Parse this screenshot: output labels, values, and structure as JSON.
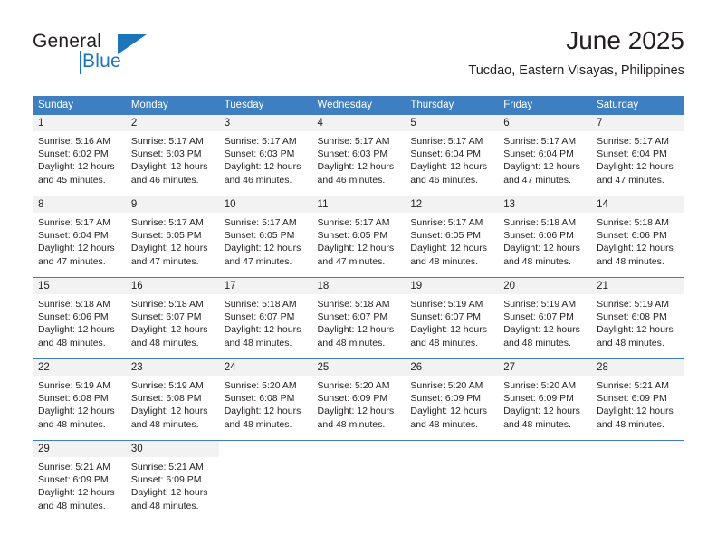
{
  "brand": {
    "name_part1": "General",
    "name_part2": "Blue",
    "accent_color": "#1b75bb"
  },
  "header": {
    "title": "June 2025",
    "subtitle": "Tucdao, Eastern Visayas, Philippines"
  },
  "calendar": {
    "header_color": "#3d7fc1",
    "daynum_band_color": "#f2f2f2",
    "weekday_headers": [
      "Sunday",
      "Monday",
      "Tuesday",
      "Wednesday",
      "Thursday",
      "Friday",
      "Saturday"
    ],
    "weeks": [
      [
        {
          "day": "1",
          "sunrise": "Sunrise: 5:16 AM",
          "sunset": "Sunset: 6:02 PM",
          "daylight": "Daylight: 12 hours and 45 minutes."
        },
        {
          "day": "2",
          "sunrise": "Sunrise: 5:17 AM",
          "sunset": "Sunset: 6:03 PM",
          "daylight": "Daylight: 12 hours and 46 minutes."
        },
        {
          "day": "3",
          "sunrise": "Sunrise: 5:17 AM",
          "sunset": "Sunset: 6:03 PM",
          "daylight": "Daylight: 12 hours and 46 minutes."
        },
        {
          "day": "4",
          "sunrise": "Sunrise: 5:17 AM",
          "sunset": "Sunset: 6:03 PM",
          "daylight": "Daylight: 12 hours and 46 minutes."
        },
        {
          "day": "5",
          "sunrise": "Sunrise: 5:17 AM",
          "sunset": "Sunset: 6:04 PM",
          "daylight": "Daylight: 12 hours and 46 minutes."
        },
        {
          "day": "6",
          "sunrise": "Sunrise: 5:17 AM",
          "sunset": "Sunset: 6:04 PM",
          "daylight": "Daylight: 12 hours and 47 minutes."
        },
        {
          "day": "7",
          "sunrise": "Sunrise: 5:17 AM",
          "sunset": "Sunset: 6:04 PM",
          "daylight": "Daylight: 12 hours and 47 minutes."
        }
      ],
      [
        {
          "day": "8",
          "sunrise": "Sunrise: 5:17 AM",
          "sunset": "Sunset: 6:04 PM",
          "daylight": "Daylight: 12 hours and 47 minutes."
        },
        {
          "day": "9",
          "sunrise": "Sunrise: 5:17 AM",
          "sunset": "Sunset: 6:05 PM",
          "daylight": "Daylight: 12 hours and 47 minutes."
        },
        {
          "day": "10",
          "sunrise": "Sunrise: 5:17 AM",
          "sunset": "Sunset: 6:05 PM",
          "daylight": "Daylight: 12 hours and 47 minutes."
        },
        {
          "day": "11",
          "sunrise": "Sunrise: 5:17 AM",
          "sunset": "Sunset: 6:05 PM",
          "daylight": "Daylight: 12 hours and 47 minutes."
        },
        {
          "day": "12",
          "sunrise": "Sunrise: 5:17 AM",
          "sunset": "Sunset: 6:05 PM",
          "daylight": "Daylight: 12 hours and 48 minutes."
        },
        {
          "day": "13",
          "sunrise": "Sunrise: 5:18 AM",
          "sunset": "Sunset: 6:06 PM",
          "daylight": "Daylight: 12 hours and 48 minutes."
        },
        {
          "day": "14",
          "sunrise": "Sunrise: 5:18 AM",
          "sunset": "Sunset: 6:06 PM",
          "daylight": "Daylight: 12 hours and 48 minutes."
        }
      ],
      [
        {
          "day": "15",
          "sunrise": "Sunrise: 5:18 AM",
          "sunset": "Sunset: 6:06 PM",
          "daylight": "Daylight: 12 hours and 48 minutes."
        },
        {
          "day": "16",
          "sunrise": "Sunrise: 5:18 AM",
          "sunset": "Sunset: 6:07 PM",
          "daylight": "Daylight: 12 hours and 48 minutes."
        },
        {
          "day": "17",
          "sunrise": "Sunrise: 5:18 AM",
          "sunset": "Sunset: 6:07 PM",
          "daylight": "Daylight: 12 hours and 48 minutes."
        },
        {
          "day": "18",
          "sunrise": "Sunrise: 5:18 AM",
          "sunset": "Sunset: 6:07 PM",
          "daylight": "Daylight: 12 hours and 48 minutes."
        },
        {
          "day": "19",
          "sunrise": "Sunrise: 5:19 AM",
          "sunset": "Sunset: 6:07 PM",
          "daylight": "Daylight: 12 hours and 48 minutes."
        },
        {
          "day": "20",
          "sunrise": "Sunrise: 5:19 AM",
          "sunset": "Sunset: 6:07 PM",
          "daylight": "Daylight: 12 hours and 48 minutes."
        },
        {
          "day": "21",
          "sunrise": "Sunrise: 5:19 AM",
          "sunset": "Sunset: 6:08 PM",
          "daylight": "Daylight: 12 hours and 48 minutes."
        }
      ],
      [
        {
          "day": "22",
          "sunrise": "Sunrise: 5:19 AM",
          "sunset": "Sunset: 6:08 PM",
          "daylight": "Daylight: 12 hours and 48 minutes."
        },
        {
          "day": "23",
          "sunrise": "Sunrise: 5:19 AM",
          "sunset": "Sunset: 6:08 PM",
          "daylight": "Daylight: 12 hours and 48 minutes."
        },
        {
          "day": "24",
          "sunrise": "Sunrise: 5:20 AM",
          "sunset": "Sunset: 6:08 PM",
          "daylight": "Daylight: 12 hours and 48 minutes."
        },
        {
          "day": "25",
          "sunrise": "Sunrise: 5:20 AM",
          "sunset": "Sunset: 6:09 PM",
          "daylight": "Daylight: 12 hours and 48 minutes."
        },
        {
          "day": "26",
          "sunrise": "Sunrise: 5:20 AM",
          "sunset": "Sunset: 6:09 PM",
          "daylight": "Daylight: 12 hours and 48 minutes."
        },
        {
          "day": "27",
          "sunrise": "Sunrise: 5:20 AM",
          "sunset": "Sunset: 6:09 PM",
          "daylight": "Daylight: 12 hours and 48 minutes."
        },
        {
          "day": "28",
          "sunrise": "Sunrise: 5:21 AM",
          "sunset": "Sunset: 6:09 PM",
          "daylight": "Daylight: 12 hours and 48 minutes."
        }
      ],
      [
        {
          "day": "29",
          "sunrise": "Sunrise: 5:21 AM",
          "sunset": "Sunset: 6:09 PM",
          "daylight": "Daylight: 12 hours and 48 minutes."
        },
        {
          "day": "30",
          "sunrise": "Sunrise: 5:21 AM",
          "sunset": "Sunset: 6:09 PM",
          "daylight": "Daylight: 12 hours and 48 minutes."
        },
        {
          "day": "",
          "sunrise": "",
          "sunset": "",
          "daylight": ""
        },
        {
          "day": "",
          "sunrise": "",
          "sunset": "",
          "daylight": ""
        },
        {
          "day": "",
          "sunrise": "",
          "sunset": "",
          "daylight": ""
        },
        {
          "day": "",
          "sunrise": "",
          "sunset": "",
          "daylight": ""
        },
        {
          "day": "",
          "sunrise": "",
          "sunset": "",
          "daylight": ""
        }
      ]
    ]
  }
}
